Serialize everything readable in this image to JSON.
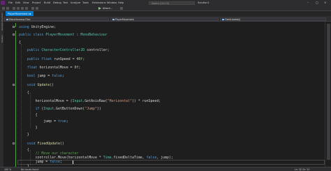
{
  "menubar": {
    "items": [
      "File",
      "Edit",
      "View",
      "Project",
      "Build",
      "Debug",
      "Test",
      "Analyze",
      "Tools",
      "Extensions",
      "Window",
      "Help"
    ],
    "search_placeholder": "Search (Ctrl+Q)",
    "solution": "Solution1"
  },
  "toolbar": {
    "attach_label": "Attach..."
  },
  "left_strip": {
    "labels": [
      "Solution Explorer",
      "Toolbox"
    ]
  },
  "tabs": [
    {
      "label": "PlayerMovement.cs",
      "close": "×"
    }
  ],
  "navbar": {
    "project": "Miscellaneous Files",
    "type": "PlayerMovement",
    "member": "FixedUpdate()"
  },
  "code": {
    "line1": "using UnityEngine;",
    "line3": "public class PlayerMovement : MonoBehaviour",
    "line4": "{",
    "line6": "public CharacterController2D controller;",
    "line8": "public float runSpeed = 40f;",
    "line10": "float horizontalMove = 0f;",
    "line12": "bool jump = false;",
    "line14": "void Update()",
    "line15": "{",
    "line17": "horizontalMove = Input.GetAxisRaw(\"Horizontal\") * runSpeed;",
    "line19": "if (Input.GetButtonDown(\"Jump\"))",
    "line20": "{",
    "line21": "jump = true;",
    "line22": "}",
    "line25": "}",
    "line27": "void FixedUpdate()",
    "line28": "{",
    "line29": "// Move our character",
    "line30": "controller.Move(horizontalMove * Time.fixedDeltaTime, false, jump);",
    "line31": "jump = false;",
    "line32": "}"
  },
  "code_tokens": {
    "using": "using",
    "ue": "UnityEngine;",
    "public": "public",
    "class": "class",
    "classname": "PlayerMovement",
    "colon": " : ",
    "mono": "MonoBehaviour",
    "cc2d": "CharacterController2D",
    "controller": " controller;",
    "float": "float",
    "runspeed": " runSpeed = ",
    "fortyf": "40f",
    "semi": ";",
    "horiz": " horizontalMove = ",
    "zerof": "0f",
    "bool": "bool",
    "jumpeq": " jump = ",
    "falsekw": "false",
    "void": "void",
    "update": "Update",
    "parens": "()",
    "hmAssign": "horizontalMove = (",
    "input": "Input",
    "getaxis": ".GetAxisRaw(",
    "horizStr": "\"Horizontal\"",
    "times": ")) * runSpeed;",
    "if": "if",
    "ifopen": " (",
    "getbtn": ".GetButtonDown(",
    "jumpStr": "\"Jump\"",
    "ifclose": "))",
    "jumpTrue": "jump = ",
    "truekw": "true",
    "fixedupdate": "FixedUpdate",
    "comment": "// Move our character",
    "ctrlmove": "controller.Move(horizontalMove * ",
    "time": "Time",
    "fdt": ".fixedDeltaTime, ",
    "jumpEnd": ", jump);",
    "jumpFalse": "jump = ",
    "lbrace": "{",
    "rbrace": "}"
  },
  "statusbar": {
    "zoom": "100 %",
    "issues": "No issues found",
    "position": "Ln: 32 Ch: 22"
  }
}
